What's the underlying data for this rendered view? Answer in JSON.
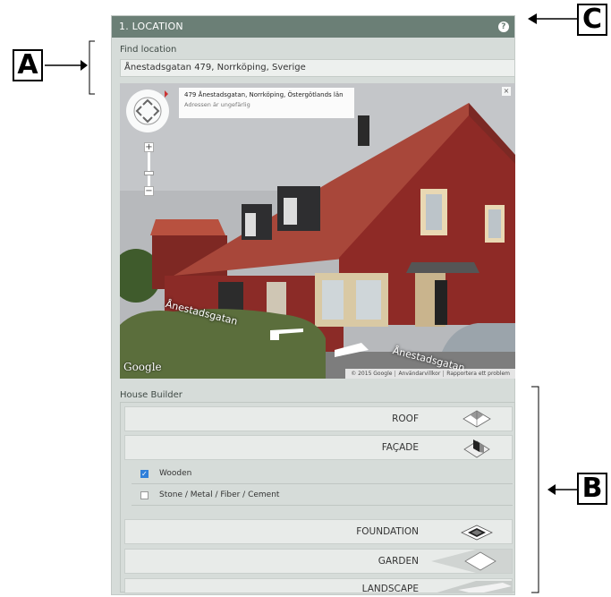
{
  "panel": {
    "title": "1. LOCATION",
    "help_icon": "?"
  },
  "find_location": {
    "label": "Find location",
    "value": "Ånestadsgatan 479, Norrköping, Sverige"
  },
  "street_view": {
    "address_main": "479 Ånestadsgatan, Norrköping, Östergötlands län",
    "address_sub": "Adressen är ungefärlig",
    "close_label": "×",
    "zoom_in": "+",
    "zoom_out": "−",
    "street_label_1": "Ånestadsgatan",
    "street_label_2": "Ånestadsgatan",
    "logo_text": "Google",
    "footer": [
      "© 2015 Google",
      "Användarvillkor",
      "Rapportera ett problem"
    ]
  },
  "house_builder": {
    "label": "House Builder",
    "rows": {
      "roof": "ROOF",
      "facade": "FAÇADE",
      "foundation": "FOUNDATION",
      "garden": "GARDEN",
      "landscape": "LANDSCAPE"
    },
    "facade_options": [
      {
        "label": "Wooden",
        "checked": true
      },
      {
        "label": "Stone / Metal / Fiber / Cement",
        "checked": false
      }
    ]
  },
  "callouts": {
    "a": "A",
    "b": "B",
    "c": "C"
  },
  "icons": [
    "help-icon",
    "close-icon",
    "compass-icon",
    "roof-icon",
    "facade-icon",
    "foundation-icon",
    "garden-icon",
    "landscape-icon",
    "checkbox-icon"
  ],
  "colors": {
    "header": "#6b7f76",
    "panel_bg": "#d6dcd9",
    "row_bg": "#e8ebe9",
    "checkbox_on": "#2f7fd9",
    "house_red": "#8e2a26"
  }
}
